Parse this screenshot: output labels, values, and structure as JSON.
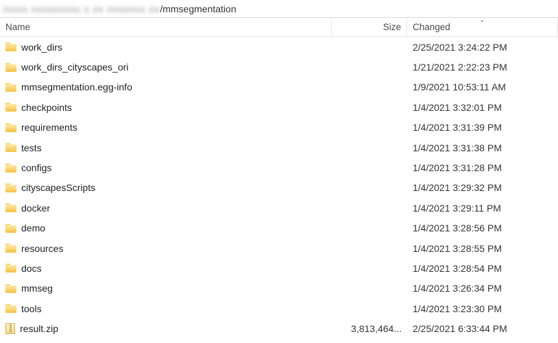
{
  "pathbar": {
    "obscured_prefix": "/xxxx xxxxxxxxx x xx xxxxxxx xx",
    "visible_suffix": "/mmsegmentation"
  },
  "columns": {
    "name": "Name",
    "size": "Size",
    "changed": "Changed"
  },
  "sort": {
    "column": "changed",
    "direction": "desc"
  },
  "rows": [
    {
      "type": "folder",
      "name": "work_dirs",
      "size": "",
      "changed": "2/25/2021 3:24:22 PM"
    },
    {
      "type": "folder",
      "name": "work_dirs_cityscapes_ori",
      "size": "",
      "changed": "1/21/2021 2:22:23 PM"
    },
    {
      "type": "folder",
      "name": "mmsegmentation.egg-info",
      "size": "",
      "changed": "1/9/2021 10:53:11 AM"
    },
    {
      "type": "folder",
      "name": "checkpoints",
      "size": "",
      "changed": "1/4/2021 3:32:01 PM"
    },
    {
      "type": "folder",
      "name": "requirements",
      "size": "",
      "changed": "1/4/2021 3:31:39 PM"
    },
    {
      "type": "folder",
      "name": "tests",
      "size": "",
      "changed": "1/4/2021 3:31:38 PM"
    },
    {
      "type": "folder",
      "name": "configs",
      "size": "",
      "changed": "1/4/2021 3:31:28 PM"
    },
    {
      "type": "folder",
      "name": "cityscapesScripts",
      "size": "",
      "changed": "1/4/2021 3:29:32 PM"
    },
    {
      "type": "folder",
      "name": "docker",
      "size": "",
      "changed": "1/4/2021 3:29:11 PM"
    },
    {
      "type": "folder",
      "name": "demo",
      "size": "",
      "changed": "1/4/2021 3:28:56 PM"
    },
    {
      "type": "folder",
      "name": "resources",
      "size": "",
      "changed": "1/4/2021 3:28:55 PM"
    },
    {
      "type": "folder",
      "name": "docs",
      "size": "",
      "changed": "1/4/2021 3:28:54 PM"
    },
    {
      "type": "folder",
      "name": "mmseg",
      "size": "",
      "changed": "1/4/2021 3:26:34 PM"
    },
    {
      "type": "folder",
      "name": "tools",
      "size": "",
      "changed": "1/4/2021 3:23:30 PM"
    },
    {
      "type": "zip",
      "name": "result.zip",
      "size": "3,813,464...",
      "changed": "2/25/2021 6:33:44 PM"
    }
  ]
}
